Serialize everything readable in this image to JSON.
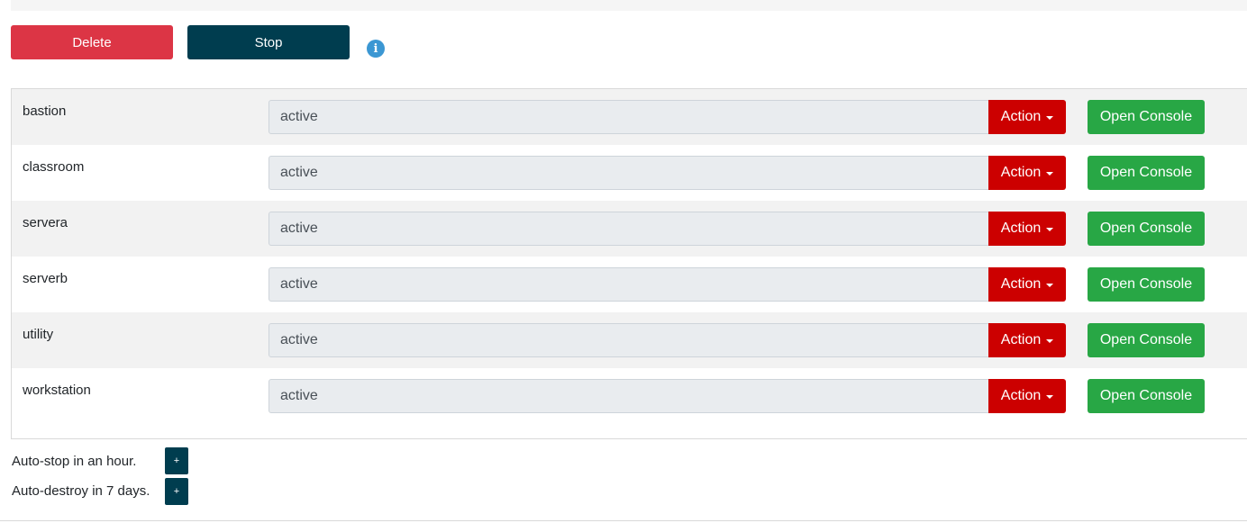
{
  "toolbar": {
    "delete_label": "Delete",
    "stop_label": "Stop",
    "info_icon": "info-icon"
  },
  "vms": [
    {
      "name": "bastion",
      "state": "active",
      "action_label": "Action",
      "console_label": "Open Console"
    },
    {
      "name": "classroom",
      "state": "active",
      "action_label": "Action",
      "console_label": "Open Console"
    },
    {
      "name": "servera",
      "state": "active",
      "action_label": "Action",
      "console_label": "Open Console"
    },
    {
      "name": "serverb",
      "state": "active",
      "action_label": "Action",
      "console_label": "Open Console"
    },
    {
      "name": "utility",
      "state": "active",
      "action_label": "Action",
      "console_label": "Open Console"
    },
    {
      "name": "workstation",
      "state": "active",
      "action_label": "Action",
      "console_label": "Open Console"
    }
  ],
  "auto": {
    "stop_text": "Auto-stop in an hour.",
    "destroy_text": "Auto-destroy in 7 days.",
    "plus_label": "+"
  },
  "colors": {
    "delete": "#dc3545",
    "stop": "#003d4f",
    "action": "#cc0000",
    "console": "#28a745",
    "info": "#3b97d3"
  }
}
